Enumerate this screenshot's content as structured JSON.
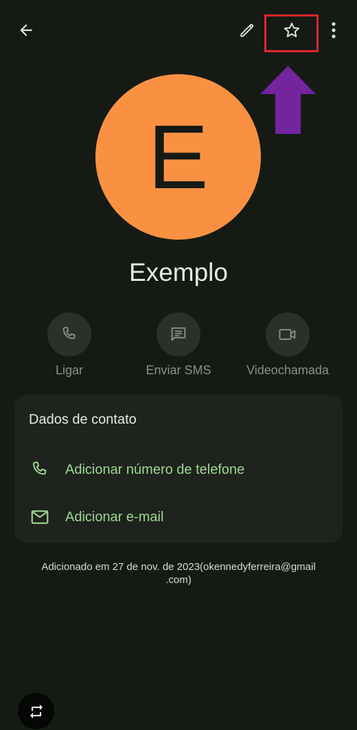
{
  "colors": {
    "background": "#151a15",
    "avatar_bg": "#fa9142",
    "accent_green": "#9fd692",
    "highlight_red": "#e4262d",
    "arrow_purple": "#7524a0"
  },
  "toolbar": {
    "back_icon": "arrow-back-icon",
    "edit_icon": "pencil-icon",
    "favorite_icon": "star-outline-icon",
    "more_icon": "more-vert-icon"
  },
  "contact": {
    "avatar_letter": "E",
    "name": "Exemplo"
  },
  "actions": [
    {
      "label": "Ligar",
      "icon": "phone-icon"
    },
    {
      "label": "Enviar SMS",
      "icon": "message-icon"
    },
    {
      "label": "Videochamada",
      "icon": "videocam-icon"
    }
  ],
  "contact_card": {
    "title": "Dados de contato",
    "rows": [
      {
        "label": "Adicionar número de telefone",
        "icon": "phone-icon"
      },
      {
        "label": "Adicionar e-mail",
        "icon": "mail-icon"
      }
    ]
  },
  "footer": {
    "line1": "Adicionado em 27 de nov. de 2023(okennedyferreira@gmail",
    "line2": ".com)"
  },
  "bottom_fab": {
    "icon": "repeat-icon"
  }
}
